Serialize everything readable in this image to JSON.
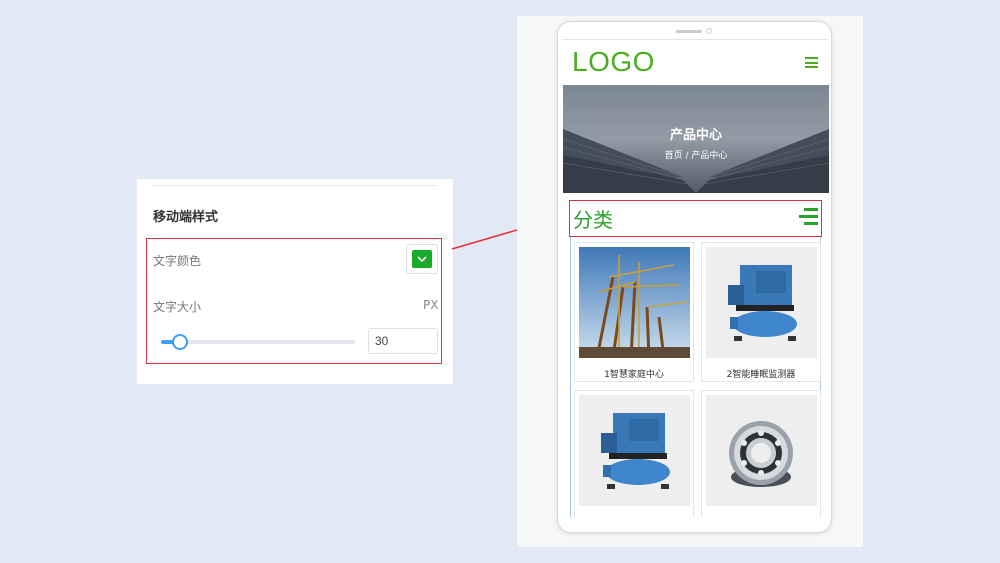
{
  "settings_panel": {
    "section_title": "移动端样式",
    "text_color_label": "文字颜色",
    "text_color_value": "#1aaa2a",
    "text_size_label": "文字大小",
    "text_size_unit": "PX",
    "text_size_value": "30",
    "slider_fraction": 0.1
  },
  "phone": {
    "logo": "LOGO",
    "banner_title": "产品中心",
    "breadcrumb": "首页 / 产品中心",
    "category_title": "分类",
    "products": [
      {
        "caption": "1智慧家庭中心"
      },
      {
        "caption": "2智能睡眠监测器"
      },
      {
        "caption": ""
      },
      {
        "caption": ""
      }
    ]
  },
  "colors": {
    "accent_green": "#4aae20",
    "highlight_red": "#d9323f",
    "slider_blue": "#409eff"
  },
  "icons": [
    "chevron-down-icon",
    "menu-icon",
    "category-list-icon"
  ]
}
